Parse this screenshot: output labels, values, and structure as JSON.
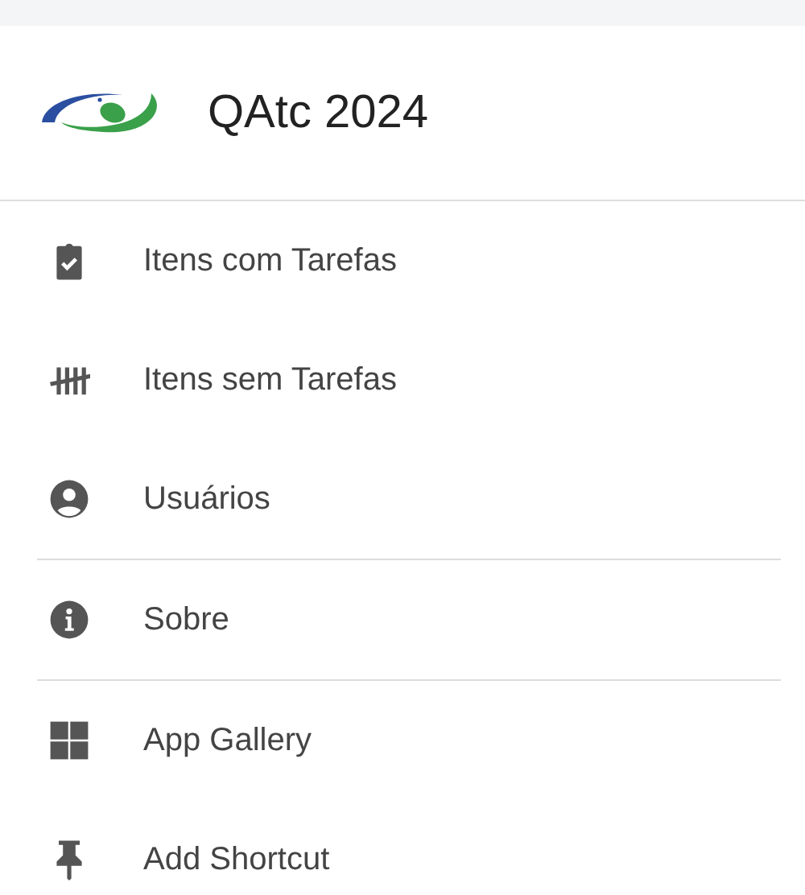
{
  "header": {
    "title": "QAtc 2024"
  },
  "sections": [
    {
      "items": [
        {
          "label": "Itens com Tarefas"
        },
        {
          "label": "Itens sem Tarefas"
        },
        {
          "label": "Usuários"
        }
      ]
    },
    {
      "items": [
        {
          "label": "Sobre"
        }
      ]
    },
    {
      "items": [
        {
          "label": "App Gallery"
        },
        {
          "label": "Add Shortcut"
        }
      ]
    }
  ]
}
